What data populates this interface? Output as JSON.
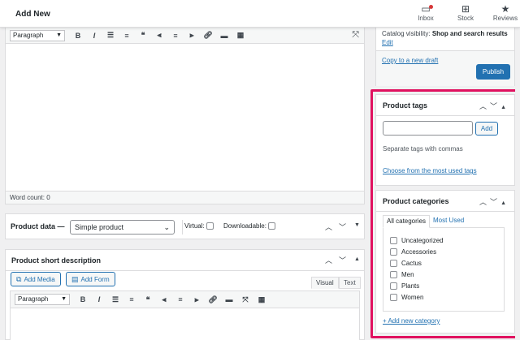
{
  "header": {
    "title": "Add New",
    "inbox_label": "Inbox",
    "stock_label": "Stock",
    "reviews_label": "Reviews"
  },
  "editor": {
    "format_select": "Paragraph",
    "word_count": "Word count: 0"
  },
  "product_data": {
    "label": "Product data —",
    "type_select": "Simple product",
    "virtual_label": "Virtual:",
    "downloadable_label": "Downloadable:"
  },
  "short_description": {
    "title": "Product short description",
    "add_media": "Add Media",
    "add_form": "Add Form",
    "tab_visual": "Visual",
    "tab_text": "Text",
    "format_select": "Paragraph"
  },
  "publish": {
    "catalog_visibility_label": "Catalog visibility:",
    "catalog_visibility_value": "Shop and search results",
    "edit_link": "Edit",
    "copy_draft": "Copy to a new draft",
    "publish_button": "Publish"
  },
  "product_tags": {
    "title": "Product tags",
    "input_value": "",
    "add_button": "Add",
    "hint": "Separate tags with commas",
    "choose_link": "Choose from the most used tags"
  },
  "product_categories": {
    "title": "Product categories",
    "tab_all": "All categories",
    "tab_most_used": "Most Used",
    "items": [
      "Uncategorized",
      "Accessories",
      "Cactus",
      "Men",
      "Plants",
      "Women"
    ],
    "add_new": "+ Add new category"
  },
  "colors": {
    "accent": "#2271b1",
    "highlight": "#e0115f",
    "notification": "#d63638"
  }
}
